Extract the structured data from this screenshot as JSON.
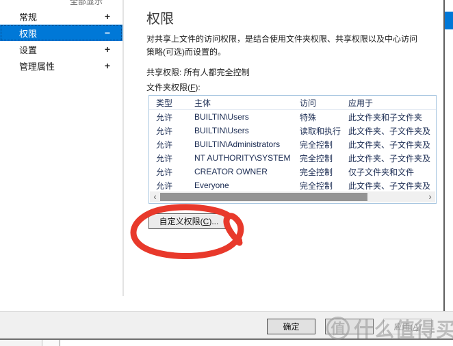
{
  "window": {
    "show_all_label": "全部显示"
  },
  "sidebar": {
    "items": [
      {
        "label": "常规",
        "toggle": "+"
      },
      {
        "label": "权限",
        "toggle": "−"
      },
      {
        "label": "设置",
        "toggle": "+"
      },
      {
        "label": "管理属性",
        "toggle": "+"
      }
    ]
  },
  "main": {
    "title": "权限",
    "description_line1": "对共享上文件的访问权限，是结合使用文件夹权限、共享权限以及中心访问",
    "description_line2": "策略(可选)而设置的。",
    "share_permission": "共享权限: 所有人都完全控制",
    "folder_label": {
      "pre": "文件夹权限(",
      "key": "F",
      "post": "):"
    },
    "table": {
      "columns": [
        "类型",
        "主体",
        "访问",
        "应用于"
      ],
      "rows": [
        {
          "type": "允许",
          "principal": "BUILTIN\\Users",
          "access": "特殊",
          "applies_to": "此文件夹和子文件夹"
        },
        {
          "type": "允许",
          "principal": "BUILTIN\\Users",
          "access": "读取和执行",
          "applies_to": "此文件夹、子文件夹及"
        },
        {
          "type": "允许",
          "principal": "BUILTIN\\Administrators",
          "access": "完全控制",
          "applies_to": "此文件夹、子文件夹及"
        },
        {
          "type": "允许",
          "principal": "NT AUTHORITY\\SYSTEM",
          "access": "完全控制",
          "applies_to": "此文件夹、子文件夹及"
        },
        {
          "type": "允许",
          "principal": "CREATOR OWNER",
          "access": "完全控制",
          "applies_to": "仅子文件夹和文件"
        },
        {
          "type": "允许",
          "principal": "Everyone",
          "access": "完全控制",
          "applies_to": "此文件夹、子文件夹及"
        }
      ],
      "scroll_left_glyph": "‹",
      "scroll_right_glyph": "›"
    },
    "customize_button": {
      "pre": "自定义权限(",
      "key": "C",
      "post": ")..."
    }
  },
  "footer": {
    "ok": "确定",
    "cancel": "",
    "apply": {
      "pre": "应用(",
      "key": "A",
      "post": ")"
    }
  },
  "watermark": {
    "badge": "值",
    "text": "什么值得买"
  },
  "colors": {
    "accent": "#0078d7",
    "annotation_red": "#e8392b",
    "table_border": "#a7c6e0",
    "footer_bg": "#f0f0f0"
  }
}
